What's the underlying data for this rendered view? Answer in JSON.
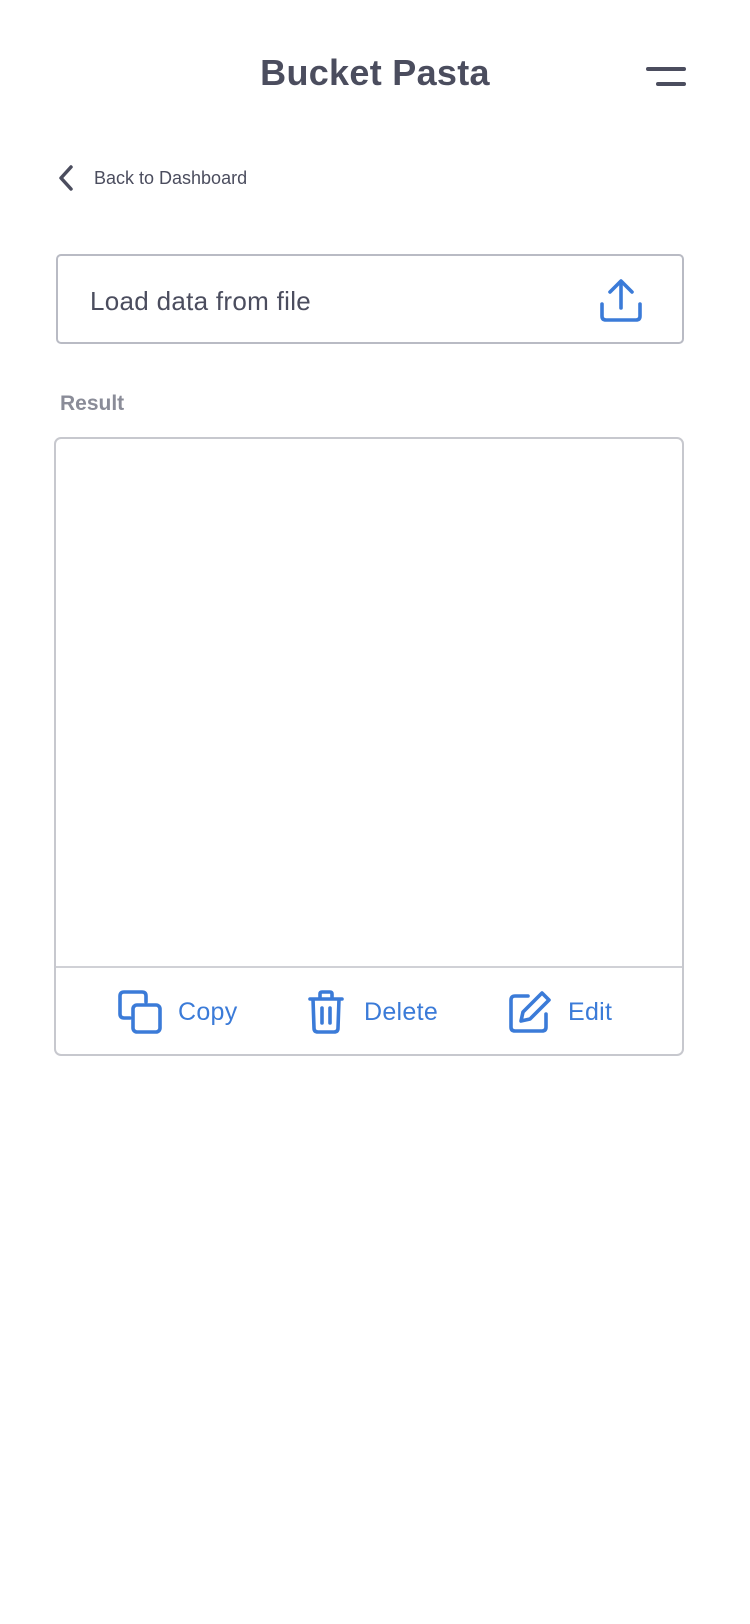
{
  "header": {
    "title": "Bucket Pasta",
    "menu_icon": "hamburger-menu-icon"
  },
  "nav": {
    "back_label": "Back to Dashboard",
    "back_icon": "chevron-left-icon"
  },
  "load": {
    "label": "Load data from file",
    "icon": "upload-icon"
  },
  "result": {
    "label": "Result",
    "content": ""
  },
  "actions": [
    {
      "label": "Copy",
      "icon": "copy-icon"
    },
    {
      "label": "Delete",
      "icon": "trash-icon"
    },
    {
      "label": "Edit",
      "icon": "edit-icon"
    }
  ],
  "colors": {
    "accent": "#3b7bd8",
    "text": "#4b4d5e",
    "muted": "#8a8c98",
    "border": "#c7c8ce"
  }
}
